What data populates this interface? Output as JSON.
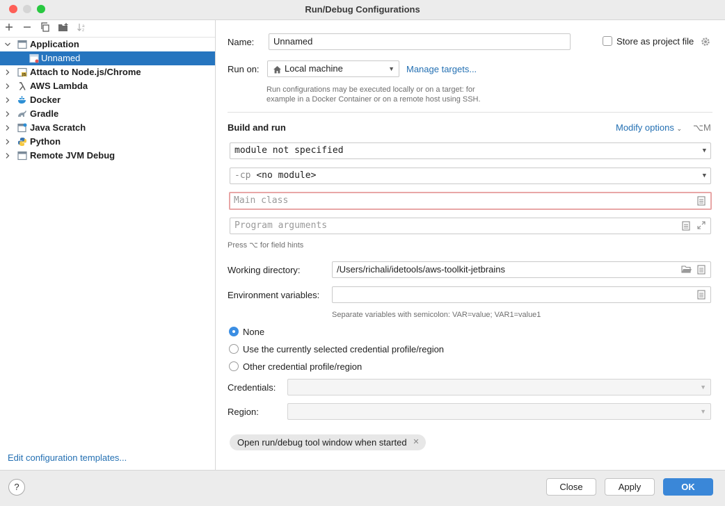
{
  "window": {
    "title": "Run/Debug Configurations"
  },
  "tree": {
    "items": [
      {
        "label": "Application",
        "expanded": true
      },
      {
        "label": "Unnamed",
        "selected": true
      },
      {
        "label": "Attach to Node.js/Chrome"
      },
      {
        "label": "AWS Lambda"
      },
      {
        "label": "Docker"
      },
      {
        "label": "Gradle"
      },
      {
        "label": "Java Scratch"
      },
      {
        "label": "Python"
      },
      {
        "label": "Remote JVM Debug"
      }
    ],
    "edit_templates": "Edit configuration templates..."
  },
  "form": {
    "name_label": "Name:",
    "name_value": "Unnamed",
    "store_label": "Store as project file",
    "run_on_label": "Run on:",
    "run_on_value": "Local machine",
    "manage_targets": "Manage targets...",
    "run_on_hint_1": "Run configurations may be executed locally or on a target: for",
    "run_on_hint_2": "example in a Docker Container or on a remote host using SSH.",
    "build_run_title": "Build and run",
    "modify_options": "Modify options",
    "modify_shortcut": "⌥M",
    "module_value": "module not specified",
    "cp_prefix": "-cp",
    "cp_value": "<no module>",
    "main_class_placeholder": "Main class",
    "program_args_placeholder": "Program arguments",
    "field_hint": "Press ⌥ for field hints",
    "working_dir_label": "Working directory:",
    "working_dir_value": "/Users/richali/idetools/aws-toolkit-jetbrains",
    "env_vars_label": "Environment variables:",
    "env_vars_value": "",
    "env_hint": "Separate variables with semicolon: VAR=value; VAR1=value1",
    "radio_none": "None",
    "radio_current": "Use the currently selected credential profile/region",
    "radio_other": "Other credential profile/region",
    "credentials_label": "Credentials:",
    "region_label": "Region:",
    "chip_label": "Open run/debug tool window when started"
  },
  "buttons": {
    "close": "Close",
    "apply": "Apply",
    "ok": "OK",
    "help": "?"
  },
  "colors": {
    "accent": "#3a87d8",
    "selection": "#2675bf",
    "link": "#2470b3",
    "error_border": "#e8a6a6"
  }
}
